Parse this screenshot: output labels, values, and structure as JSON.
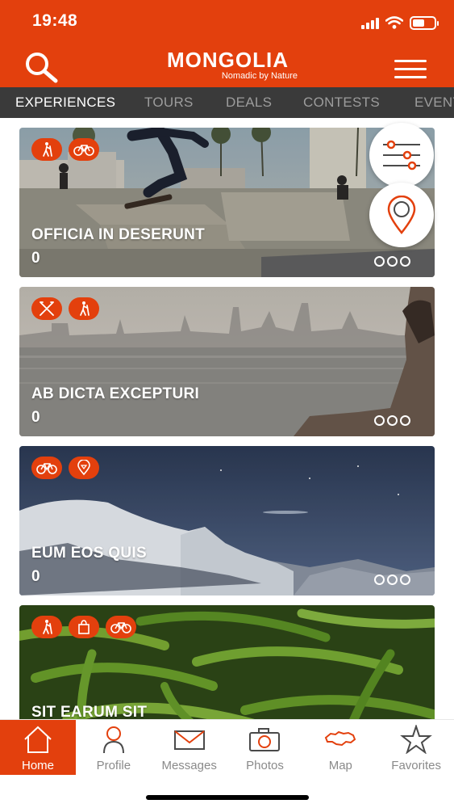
{
  "status_bar": {
    "time": "19:48",
    "battery_level": 0.55
  },
  "header": {
    "logo_title": "MONGOLIA",
    "logo_subtitle": "Nomadic by Nature",
    "search_icon": "search-icon",
    "menu_icon": "hamburger-menu-icon"
  },
  "tabs": [
    {
      "label": "EXPERIENCES",
      "active": true
    },
    {
      "label": "TOURS",
      "active": false
    },
    {
      "label": "DEALS",
      "active": false
    },
    {
      "label": "CONTESTS",
      "active": false
    },
    {
      "label": "EVENTS",
      "active": false
    }
  ],
  "cards": [
    {
      "title": "OFFICIA IN DESERUNT",
      "count": "0",
      "icons": [
        "hiking-icon",
        "bicycle-icon"
      ]
    },
    {
      "title": "AB DICTA EXCEPTURI",
      "count": "0",
      "icons": [
        "restaurant-icon",
        "hiking-icon"
      ]
    },
    {
      "title": "EUM EOS QUIS",
      "count": "0",
      "icons": [
        "bicycle-icon",
        "location-pin-icon"
      ]
    },
    {
      "title": "SIT EARUM SIT",
      "count": "",
      "icons": [
        "hiking-icon",
        "shopping-bag-icon",
        "bicycle-icon"
      ]
    }
  ],
  "floating_buttons": {
    "filter_icon": "filter-sliders-icon",
    "map_icon": "map-pin-icon"
  },
  "bottom_nav": [
    {
      "label": "Home",
      "icon": "home-icon",
      "active": true
    },
    {
      "label": "Profile",
      "icon": "profile-icon",
      "active": false
    },
    {
      "label": "Messages",
      "icon": "envelope-icon",
      "active": false
    },
    {
      "label": "Photos",
      "icon": "camera-icon",
      "active": false
    },
    {
      "label": "Map",
      "icon": "mongolia-map-icon",
      "active": false
    },
    {
      "label": "Favorites",
      "icon": "star-icon",
      "active": false
    }
  ],
  "colors": {
    "accent": "#e3400d",
    "tab_bar": "#3a3a3a",
    "tab_inactive": "#9c9c9c"
  }
}
